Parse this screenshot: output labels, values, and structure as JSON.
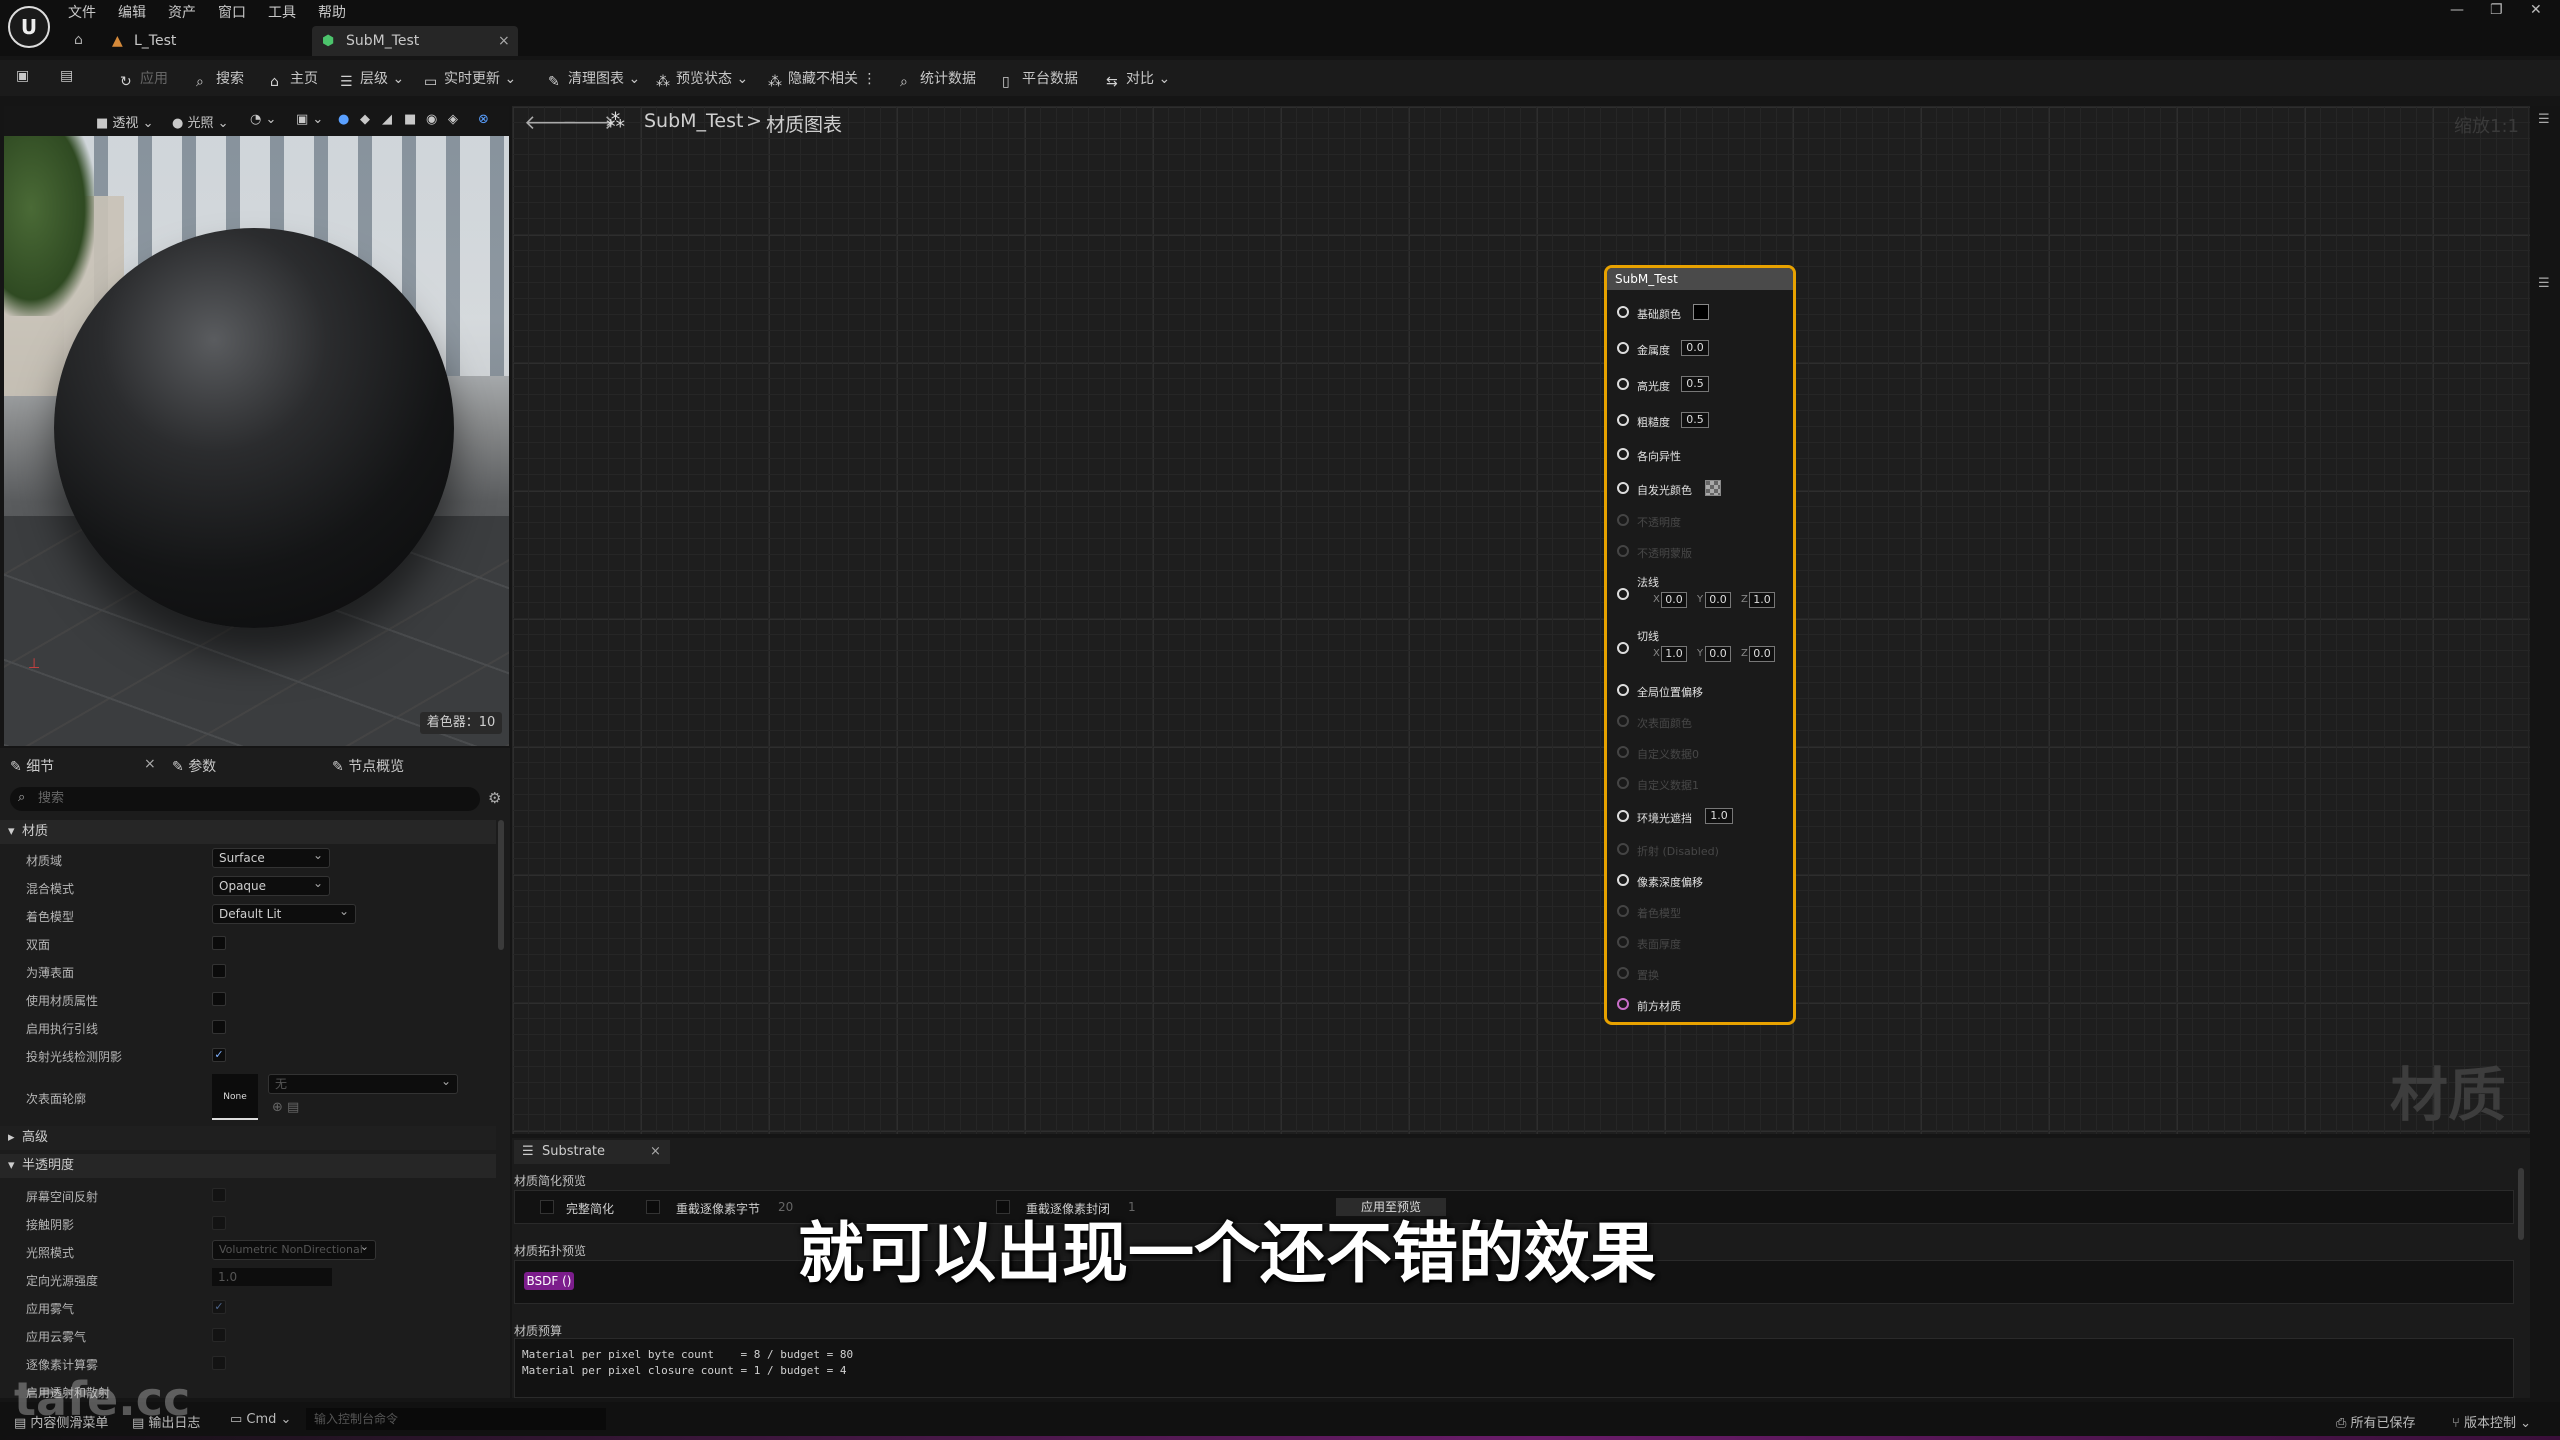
{
  "menu": [
    "文件",
    "编辑",
    "资产",
    "窗口",
    "工具",
    "帮助"
  ],
  "tabs": [
    {
      "label": "L_Test"
    },
    {
      "label": "SubM_Test"
    }
  ],
  "toolbar": {
    "apply": "应用",
    "search": "搜索",
    "home": "主页",
    "hierarchy": "层级",
    "live_update": "实时更新",
    "clean_graph": "清理图表",
    "preview_state": "预览状态",
    "hide_unrelated": "隐藏不相关",
    "stats": "统计数据",
    "platform_stats": "平台数据",
    "compare": "对比"
  },
  "viewport": {
    "perspective": "透视",
    "lit": "光照",
    "shader_count": "着色器：10"
  },
  "details": {
    "tabs": [
      "细节",
      "参数",
      "节点概览"
    ],
    "search_placeholder": "搜索",
    "section_material": "材质",
    "rows": [
      {
        "label": "材质域",
        "value": "Surface"
      },
      {
        "label": "混合模式",
        "value": "Opaque"
      },
      {
        "label": "着色模型",
        "value": "Default Lit"
      },
      {
        "label": "双面"
      },
      {
        "label": "为薄表面"
      },
      {
        "label": "使用材质属性"
      },
      {
        "label": "启用执行引线"
      },
      {
        "label": "投射光线检测阴影",
        "checked": "✓"
      },
      {
        "label": "次表面轮廓",
        "thumb": "None",
        "value": "无"
      }
    ],
    "section_advanced": "高级",
    "section_translucency": "半透明度",
    "trans_rows": [
      {
        "label": "屏幕空间反射"
      },
      {
        "label": "接触阴影"
      },
      {
        "label": "光照模式",
        "value": "Volumetric NonDirectional"
      },
      {
        "label": "定向光源强度",
        "value": "1.0"
      },
      {
        "label": "应用雾气",
        "checked": "✓"
      },
      {
        "label": "应用云雾气"
      },
      {
        "label": "逐像素计算雾"
      },
      {
        "label": "启用透射和散射"
      }
    ]
  },
  "breadcrumb": {
    "asset": "SubM_Test",
    "sep": ">",
    "graph": "材质图表"
  },
  "zoom": "缩放1:1",
  "graph_watermark": "材质",
  "node": {
    "title": "SubM_Test",
    "pins": [
      {
        "label": "基础颜色"
      },
      {
        "label": "金属度",
        "value": "0.0"
      },
      {
        "label": "高光度",
        "value": "0.5"
      },
      {
        "label": "粗糙度",
        "value": "0.5"
      },
      {
        "label": "各向异性"
      },
      {
        "label": "自发光颜色"
      },
      {
        "label": "不透明度"
      },
      {
        "label": "不透明蒙版"
      },
      {
        "label": "法线",
        "x": "0.0",
        "y": "0.0",
        "z": "1.0"
      },
      {
        "label": "切线",
        "x": "1.0",
        "y": "0.0",
        "z": "0.0"
      },
      {
        "label": "全局位置偏移"
      },
      {
        "label": "次表面颜色"
      },
      {
        "label": "自定义数据0"
      },
      {
        "label": "自定义数据1"
      },
      {
        "label": "环境光遮挡",
        "value": "1.0"
      },
      {
        "label": "折射 (Disabled)"
      },
      {
        "label": "像素深度偏移"
      },
      {
        "label": "着色模型"
      },
      {
        "label": "表面厚度"
      },
      {
        "label": "置换"
      },
      {
        "label": "前方材质"
      }
    ],
    "axis": {
      "x": "X",
      "y": "Y",
      "z": "Z"
    }
  },
  "substrate": {
    "tab": "Substrate",
    "simplify_preview": "材质简化预览",
    "full_simplify": "完整简化",
    "crop_bytes": "重截逐像素字节",
    "crop_bytes_value": "20",
    "crop_closures": "重截逐像素封闭",
    "crop_closures_value": "1",
    "apply_preview": "应用至预览",
    "topology": "材质拓扑预览",
    "bsdf": "BSDF ()",
    "budget_title": "材质预算",
    "budget_lines": [
      "Material per pixel byte count    = 8 / budget = 80",
      "Material per pixel closure count = 1 / budget = 4"
    ]
  },
  "subtitle": "就可以出现一个还不错的效果",
  "status": {
    "content_drawer": "内容侧滑菜单",
    "output_log": "输出日志",
    "cmd": "Cmd",
    "cmd_placeholder": "输入控制台命令",
    "all_saved": "所有已保存",
    "source_control": "版本控制"
  },
  "site_watermark": "tafe.cc",
  "colors": {
    "node_border": "#e8a200",
    "bsdf": "#7c1d8c",
    "accent": "#7fb2ff"
  }
}
